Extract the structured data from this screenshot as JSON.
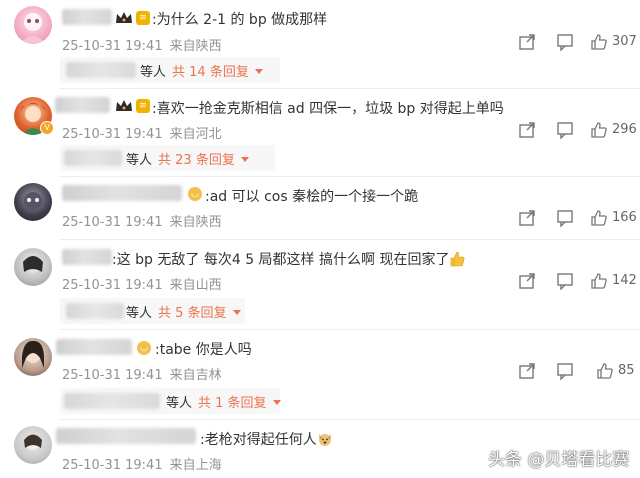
{
  "comments": [
    {
      "text": ":为什么 2-1 的 bp 做成那样",
      "time": "25-10-31 19:41",
      "location": "来自陕西",
      "likes": "307",
      "reply": {
        "etc": "等人",
        "count": "共 14 条回复"
      }
    },
    {
      "text": ":喜欢一抢金克斯相信 ad 四保一，垃圾 bp 对得起上单吗",
      "time": "25-10-31 19:41",
      "location": "来自河北",
      "likes": "296",
      "reply": {
        "etc": "等人",
        "count": "共 23 条回复"
      }
    },
    {
      "text": ":ad 可以 cos 秦桧的一个接一个跪",
      "time": "25-10-31 19:41",
      "location": "来自陕西",
      "likes": "166"
    },
    {
      "text": ":这 bp 无敌了 每次4 5 局都这样 搞什么啊 现在回家了",
      "time": "25-10-31 19:41",
      "location": "来自山西",
      "likes": "142",
      "reply": {
        "etc": "等人",
        "count": "共 5 条回复"
      }
    },
    {
      "text": ":tabe 你是人吗",
      "time": "25-10-31 19:41",
      "location": "来自吉林",
      "likes": "85",
      "reply": {
        "etc": "等人",
        "count": "共 1 条回复"
      }
    },
    {
      "text": ":老枪对得起任何人",
      "time": "25-10-31 19:41",
      "location": "来自上海"
    }
  ],
  "watermark": "头条 @贝塔看比赛",
  "icons": {
    "share": "share-icon",
    "comment": "comment-icon",
    "like": "thumbs-up-icon"
  },
  "colors": {
    "reply_accent": "#eb7350",
    "meta_gray": "#939393",
    "level_badge": "#f0b400"
  }
}
